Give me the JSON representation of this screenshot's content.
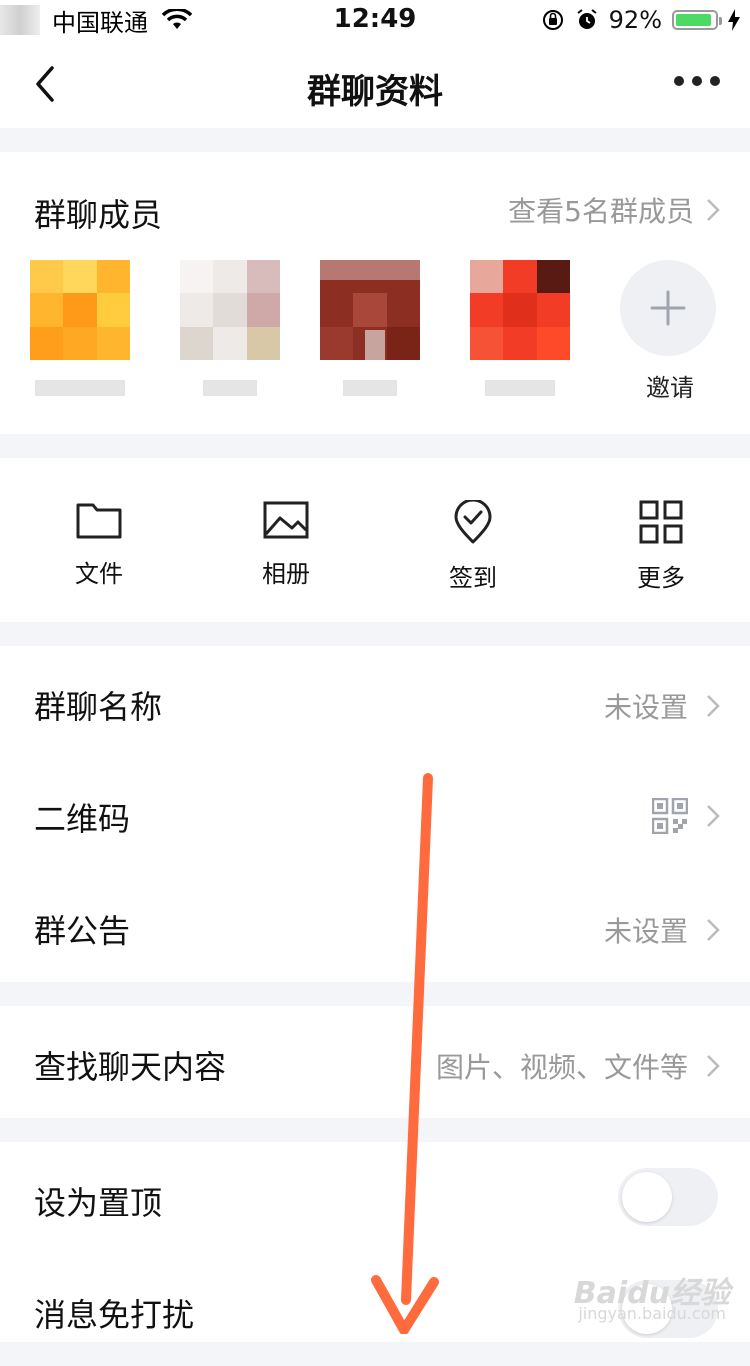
{
  "status_bar": {
    "carrier": "中国联通",
    "time": "12:49",
    "battery_percent": "92%",
    "battery_level": 0.92,
    "battery_color": "#4cd964"
  },
  "nav": {
    "title": "群聊资料",
    "back_icon": "chevron-left-icon",
    "more_icon": "more-dots-icon"
  },
  "members": {
    "title": "群聊成员",
    "view_all": "查看5名群成员",
    "invite_label": "邀请"
  },
  "tools": [
    {
      "label": "文件",
      "icon": "folder-icon"
    },
    {
      "label": "相册",
      "icon": "image-icon"
    },
    {
      "label": "签到",
      "icon": "location-check-icon"
    },
    {
      "label": "更多",
      "icon": "grid-icon"
    }
  ],
  "settings": {
    "group_name": {
      "label": "群聊名称",
      "value": "未设置"
    },
    "qr_code": {
      "label": "二维码",
      "icon": "qrcode-icon"
    },
    "announcement": {
      "label": "群公告",
      "value": "未设置"
    }
  },
  "search": {
    "label": "查找聊天内容",
    "value": "图片、视频、文件等"
  },
  "toggles": {
    "pin": {
      "label": "设为置顶",
      "on": false
    },
    "mute": {
      "label": "消息免打扰",
      "on": false
    }
  },
  "watermark": {
    "brand": "Baidu经验",
    "url": "jingyan.baidu.com"
  },
  "colors": {
    "annotation_arrow": "#ff6b3d",
    "page_bg": "#f4f5f8"
  }
}
